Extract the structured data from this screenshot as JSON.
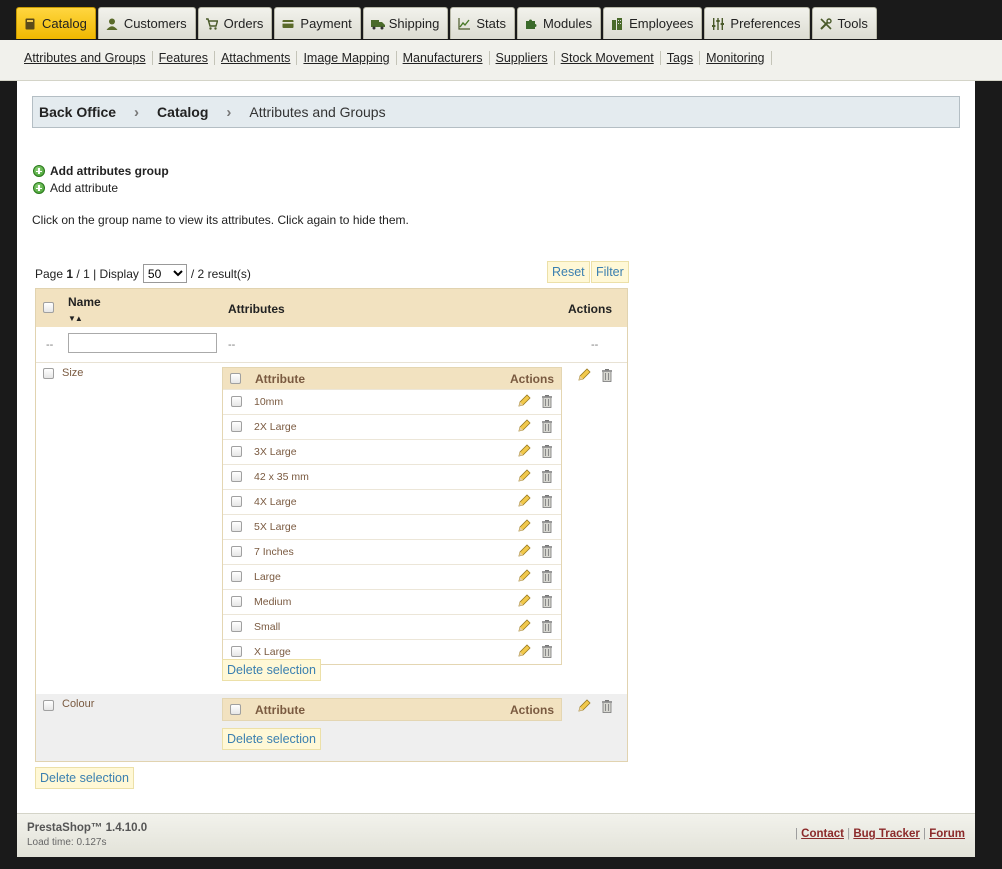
{
  "tabs": [
    {
      "label": "Catalog",
      "icon": "book-icon",
      "active": true
    },
    {
      "label": "Customers",
      "icon": "user-icon",
      "active": false
    },
    {
      "label": "Orders",
      "icon": "cart-icon",
      "active": false
    },
    {
      "label": "Payment",
      "icon": "card-icon",
      "active": false
    },
    {
      "label": "Shipping",
      "icon": "truck-icon",
      "active": false
    },
    {
      "label": "Stats",
      "icon": "chart-icon",
      "active": false
    },
    {
      "label": "Modules",
      "icon": "puzzle-icon",
      "active": false
    },
    {
      "label": "Employees",
      "icon": "building-icon",
      "active": false
    },
    {
      "label": "Preferences",
      "icon": "sliders-icon",
      "active": false
    },
    {
      "label": "Tools",
      "icon": "wrench-icon",
      "active": false
    }
  ],
  "subnav": [
    "Attributes and Groups",
    "Features",
    "Attachments",
    "Image Mapping",
    "Manufacturers",
    "Suppliers",
    "Stock Movement",
    "Tags",
    "Monitoring"
  ],
  "breadcrumb": [
    "Back Office",
    "Catalog",
    "Attributes and Groups"
  ],
  "actions": {
    "add_group": "Add attributes group",
    "add_attribute": "Add attribute"
  },
  "help_text": "Click on the group name to view its attributes. Click again to hide them.",
  "pager": {
    "page_prefix": "Page",
    "current_page": "1",
    "total_pages": "/ 1",
    "display_label": "| Display",
    "display_value": "50",
    "results": "/ 2 result(s)",
    "reset": "Reset",
    "filter": "Filter"
  },
  "table": {
    "col_name": "Name",
    "col_attributes": "Attributes",
    "col_actions": "Actions",
    "filter_dash": "--",
    "inner_col_attribute": "Attribute",
    "inner_col_actions": "Actions",
    "delete_selection": "Delete selection",
    "groups": [
      {
        "name": "Size",
        "attributes": [
          "10mm",
          "2X Large",
          "3X Large",
          "42 x 35 mm",
          "4X Large",
          "5X Large",
          "7 Inches",
          "Large",
          "Medium",
          "Small",
          "X Large"
        ]
      },
      {
        "name": "Colour",
        "attributes": []
      }
    ]
  },
  "bottom_delete": "Delete selection",
  "footer": {
    "version": "PrestaShop™ 1.4.10.0",
    "load_time": "Load time: 0.127s",
    "links": [
      "Contact",
      "Bug Tracker",
      "Forum"
    ]
  },
  "colors": {
    "active_tab": "#f0b800",
    "header_bg": "#f2e2c0",
    "breadcrumb_bg": "#e4ebef"
  }
}
